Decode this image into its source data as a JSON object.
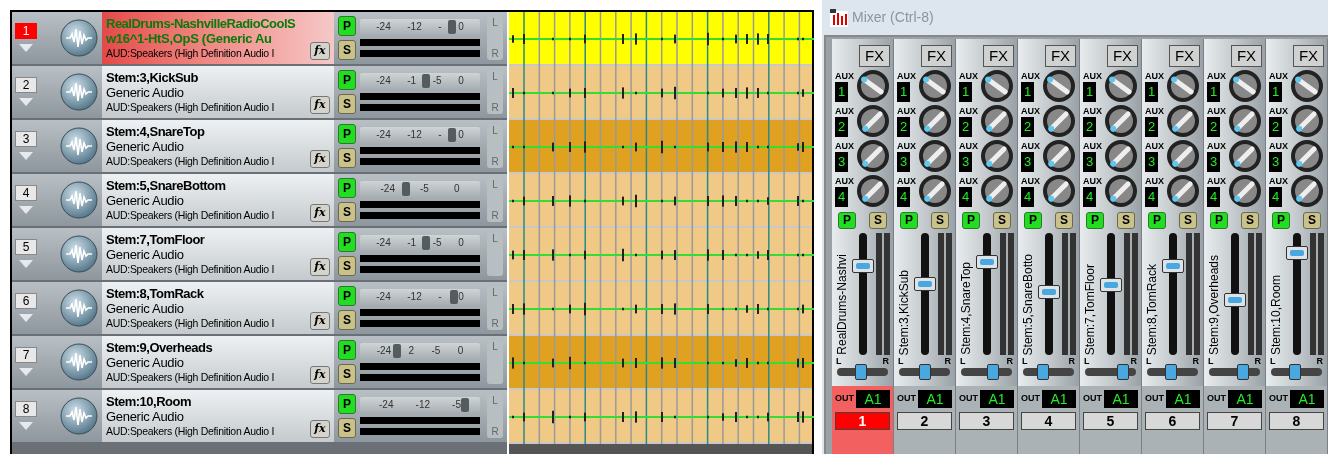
{
  "tracks": [
    {
      "number": "1",
      "selected": true,
      "name": "RealDrums-NashvilleRadioCoolS",
      "line2": "w16^1-HtS,OpS (Generic Au",
      "line3": "AUD:Speakers (High Definition Audio I",
      "p": "P",
      "s": "S",
      "fx": "fx",
      "volume": {
        "level": 0.8,
        "scale": [
          "-24",
          "-12",
          "-",
          "0"
        ]
      },
      "pan": {
        "labels": [
          "L",
          "R"
        ]
      },
      "lane": {
        "color": "#ffff00"
      }
    },
    {
      "number": "2",
      "selected": false,
      "name": "Stem:3,KickSub",
      "line2": "Generic Audio",
      "line3": "AUD:Speakers (High Definition Audio I",
      "p": "P",
      "s": "S",
      "fx": "fx",
      "volume": {
        "level": 0.56,
        "scale": [
          "-24",
          "-1",
          "-5",
          "0"
        ]
      },
      "pan": {
        "labels": [
          "L",
          "R"
        ]
      },
      "lane": {
        "color": "#f0c987"
      }
    },
    {
      "number": "3",
      "selected": false,
      "name": "Stem:4,SnareTop",
      "line2": "Generic Audio",
      "line3": "AUD:Speakers (High Definition Audio I",
      "p": "P",
      "s": "S",
      "fx": "fx",
      "volume": {
        "level": 0.8,
        "scale": [
          "-24",
          "-12",
          "-",
          "0"
        ]
      },
      "pan": {
        "labels": [
          "L",
          "R"
        ]
      },
      "lane": {
        "color": "#e0a020"
      }
    },
    {
      "number": "4",
      "selected": false,
      "name": "Stem:5,SnareBottom",
      "line2": "Generic Audio",
      "line3": "AUD:Speakers (High Definition Audio I",
      "p": "P",
      "s": "S",
      "fx": "fx",
      "volume": {
        "level": 0.38,
        "scale": [
          "-24",
          "-5",
          "0"
        ]
      },
      "pan": {
        "labels": [
          "L",
          "R"
        ]
      },
      "lane": {
        "color": "#f0c987"
      }
    },
    {
      "number": "5",
      "selected": false,
      "name": "Stem:7,TomFloor",
      "line2": "Generic Audio",
      "line3": "AUD:Speakers (High Definition Audio I",
      "p": "P",
      "s": "S",
      "fx": "fx",
      "volume": {
        "level": 0.56,
        "scale": [
          "-24",
          "-1",
          "-5",
          "0"
        ]
      },
      "pan": {
        "labels": [
          "L"
        ]
      },
      "lane": {
        "color": "#f0c987"
      }
    },
    {
      "number": "6",
      "selected": false,
      "name": "Stem:8,TomRack",
      "line2": "Generic Audio",
      "line3": "AUD:Speakers (High Definition Audio I",
      "p": "P",
      "s": "S",
      "fx": "fx",
      "volume": {
        "level": 0.82,
        "scale": [
          "-24",
          "-12",
          "-",
          "0"
        ]
      },
      "pan": {
        "labels": [
          "L",
          "R"
        ]
      },
      "lane": {
        "color": "#f0c987"
      }
    },
    {
      "number": "7",
      "selected": false,
      "name": "Stem:9,Overheads",
      "line2": "Generic Audio",
      "line3": "AUD:Speakers (High Definition Audio I",
      "p": "P",
      "s": "S",
      "fx": "fx",
      "volume": {
        "level": 0.3,
        "scale": [
          "-24",
          "2",
          "-5",
          "0"
        ]
      },
      "pan": {
        "labels": [
          "L"
        ]
      },
      "lane": {
        "color": "#e0a020"
      }
    },
    {
      "number": "8",
      "selected": false,
      "name": "Stem:10,Room",
      "line2": "Generic Audio",
      "line3": "AUD:Speakers (High Definition Audio I",
      "p": "P",
      "s": "S",
      "fx": "fx",
      "volume": {
        "level": 0.92,
        "scale": [
          "-24",
          "-12",
          "-5"
        ]
      },
      "pan": {
        "labels": [
          "L",
          "R"
        ]
      },
      "lane": {
        "color": "#f0c987"
      }
    }
  ],
  "mixer": {
    "title": "Mixer (Ctrl-8)",
    "strips": [
      {
        "number": "1",
        "selected": true,
        "name": "RealDrums-Nashvi",
        "fx": "FX",
        "aux": [
          {
            "label": "AUX",
            "number": "1"
          },
          {
            "label": "AUX",
            "number": "2"
          },
          {
            "label": "AUX",
            "number": "3"
          },
          {
            "label": "AUX",
            "number": "4"
          }
        ],
        "p": "P",
        "s": "S",
        "pan": {
          "level": 0.45,
          "left": "L",
          "right": "R"
        },
        "out_label": "OUT",
        "out": "A1"
      },
      {
        "number": "2",
        "selected": false,
        "name": "Stem:3,KickSub",
        "fx": "FX",
        "aux": [
          {
            "label": "AUX",
            "number": "1"
          },
          {
            "label": "AUX",
            "number": "2"
          },
          {
            "label": "AUX",
            "number": "3"
          },
          {
            "label": "AUX",
            "number": "4"
          }
        ],
        "p": "P",
        "s": "S",
        "pan": {
          "level": 0.5,
          "left": "L",
          "right": "R"
        },
        "out_label": "OUT",
        "out": "A1"
      },
      {
        "number": "3",
        "selected": false,
        "name": "Stem:4,SnareTop",
        "fx": "FX",
        "aux": [
          {
            "label": "AUX",
            "number": "1"
          },
          {
            "label": "AUX",
            "number": "2"
          },
          {
            "label": "AUX",
            "number": "3"
          },
          {
            "label": "AUX",
            "number": "4"
          }
        ],
        "p": "P",
        "s": "S",
        "pan": {
          "level": 0.65,
          "left": "L",
          "right": "R"
        },
        "out_label": "OUT",
        "out": "A1"
      },
      {
        "number": "4",
        "selected": false,
        "name": "Stem:5,SnareBotto",
        "fx": "FX",
        "aux": [
          {
            "label": "AUX",
            "number": "1"
          },
          {
            "label": "AUX",
            "number": "2"
          },
          {
            "label": "AUX",
            "number": "3"
          },
          {
            "label": "AUX",
            "number": "4"
          }
        ],
        "p": "P",
        "s": "S",
        "pan": {
          "level": 0.35,
          "left": "L",
          "right": "R"
        },
        "out_label": "OUT",
        "out": "A1"
      },
      {
        "number": "5",
        "selected": false,
        "name": "Stem:7,TomFloor",
        "fx": "FX",
        "aux": [
          {
            "label": "AUX",
            "number": "1"
          },
          {
            "label": "AUX",
            "number": "2"
          },
          {
            "label": "AUX",
            "number": "3"
          },
          {
            "label": "AUX",
            "number": "4"
          }
        ],
        "p": "P",
        "s": "S",
        "pan": {
          "level": 0.8,
          "left": "L",
          "right": "R"
        },
        "out_label": "OUT",
        "out": "A1"
      },
      {
        "number": "6",
        "selected": false,
        "name": "Stem:8,TomRack",
        "fx": "FX",
        "aux": [
          {
            "label": "AUX",
            "number": "1"
          },
          {
            "label": "AUX",
            "number": "2"
          },
          {
            "label": "AUX",
            "number": "3"
          },
          {
            "label": "AUX",
            "number": "4"
          }
        ],
        "p": "P",
        "s": "S",
        "pan": {
          "level": 0.45,
          "left": "L",
          "right": "R"
        },
        "out_label": "OUT",
        "out": "A1"
      },
      {
        "number": "7",
        "selected": false,
        "name": "Stem:9,Overheads",
        "fx": "FX",
        "aux": [
          {
            "label": "AUX",
            "number": "1"
          },
          {
            "label": "AUX",
            "number": "2"
          },
          {
            "label": "AUX",
            "number": "3"
          },
          {
            "label": "AUX",
            "number": "4"
          }
        ],
        "p": "P",
        "s": "S",
        "pan": {
          "level": 0.7,
          "left": "L",
          "right": "R"
        },
        "out_label": "OUT",
        "out": "A1"
      },
      {
        "number": "8",
        "selected": false,
        "name": "Stem:10,Room",
        "fx": "FX",
        "aux": [
          {
            "label": "AUX",
            "number": "1"
          },
          {
            "label": "AUX",
            "number": "2"
          },
          {
            "label": "AUX",
            "number": "3"
          },
          {
            "label": "AUX",
            "number": "4"
          }
        ],
        "p": "P",
        "s": "S",
        "pan": {
          "level": 0.45,
          "left": "L",
          "right": "R"
        },
        "out_label": "OUT",
        "out": "A1"
      }
    ]
  }
}
